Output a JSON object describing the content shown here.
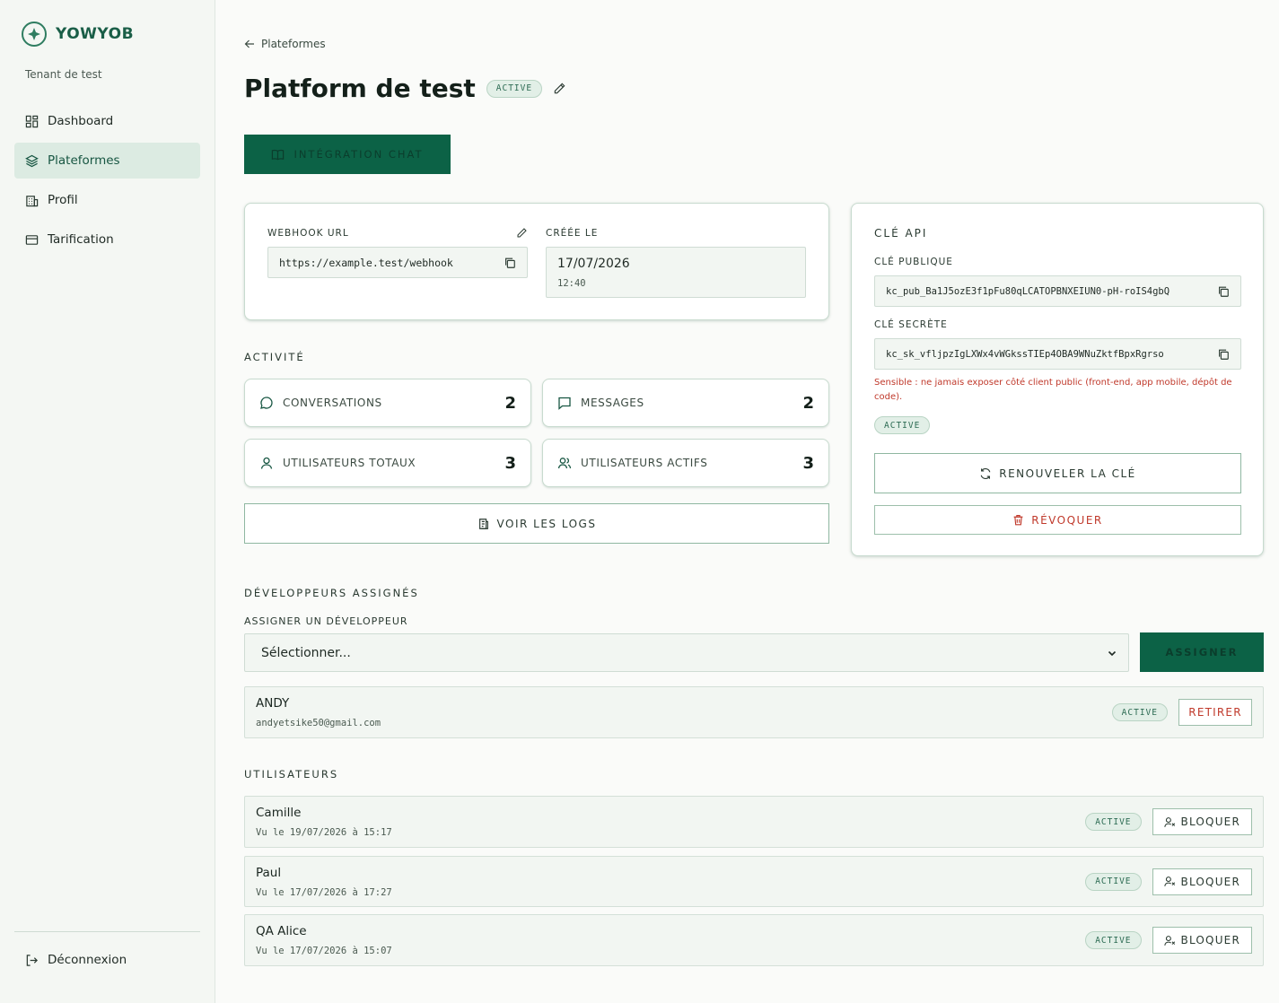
{
  "brand": {
    "name": "YOWYOB"
  },
  "sidebar": {
    "tenant": "Tenant de test",
    "items": [
      {
        "label": "Dashboard",
        "icon": "dashboard-icon",
        "active": false
      },
      {
        "label": "Plateformes",
        "icon": "layers-icon",
        "active": true
      },
      {
        "label": "Profil",
        "icon": "building-icon",
        "active": false
      },
      {
        "label": "Tarification",
        "icon": "card-icon",
        "active": false
      }
    ],
    "logout": "Déconnexion"
  },
  "header": {
    "back_label": "Plateformes",
    "title": "Platform de test",
    "status": "ACTIVE",
    "chat_button": "INTÉGRATION CHAT"
  },
  "info": {
    "webhook_label": "WEBHOOK URL",
    "webhook_value": "https://example.test/webhook",
    "created_label": "CRÉÉE LE",
    "created_date": "17/07/2026",
    "created_time": "12:40"
  },
  "activity": {
    "title": "ACTIVITÉ",
    "stats": [
      {
        "label": "CONVERSATIONS",
        "value": "2"
      },
      {
        "label": "MESSAGES",
        "value": "2"
      },
      {
        "label": "UTILISATEURS TOTAUX",
        "value": "3"
      },
      {
        "label": "UTILISATEURS ACTIFS",
        "value": "3"
      }
    ],
    "logs_button": "VOIR LES LOGS"
  },
  "api": {
    "title": "CLÉ API",
    "public_label": "CLÉ PUBLIQUE",
    "public_key": "kc_pub_Ba1J5ozE3f1pFu80qLCATOPBNXEIUN0-pH-roIS4gbQ",
    "secret_label": "CLÉ SECRÈTE",
    "secret_key": "kc_sk_vfljpzIgLXWx4vWGkssTIEp4OBA9WNuZktfBpxRgrso",
    "warning": "Sensible : ne jamais exposer côté client public (front-end, app mobile, dépôt de code).",
    "status": "ACTIVE",
    "renew_button": "RENOUVELER LA CLÉ",
    "revoke_button": "RÉVOQUER"
  },
  "developers": {
    "title": "DÉVELOPPEURS ASSIGNÉS",
    "assign_label": "ASSIGNER UN DÉVELOPPEUR",
    "select_value": "Sélectionner...",
    "assign_button": "ASSIGNER",
    "list": [
      {
        "name": "ANDY",
        "email": "andyetsike50@gmail.com",
        "status": "ACTIVE",
        "action": "RETIRER"
      }
    ]
  },
  "users": {
    "title": "UTILISATEURS",
    "list": [
      {
        "name": "Camille",
        "seen": "Vu le 19/07/2026 à 15:17",
        "status": "ACTIVE",
        "action": "BLOQUER"
      },
      {
        "name": "Paul",
        "seen": "Vu le 17/07/2026 à 17:27",
        "status": "ACTIVE",
        "action": "BLOQUER"
      },
      {
        "name": "QA Alice",
        "seen": "Vu le 17/07/2026 à 15:07",
        "status": "ACTIVE",
        "action": "BLOQUER"
      }
    ]
  },
  "colors": {
    "accent": "#0c6246",
    "danger": "#c0392b",
    "badge_bg": "#e2efe7"
  }
}
